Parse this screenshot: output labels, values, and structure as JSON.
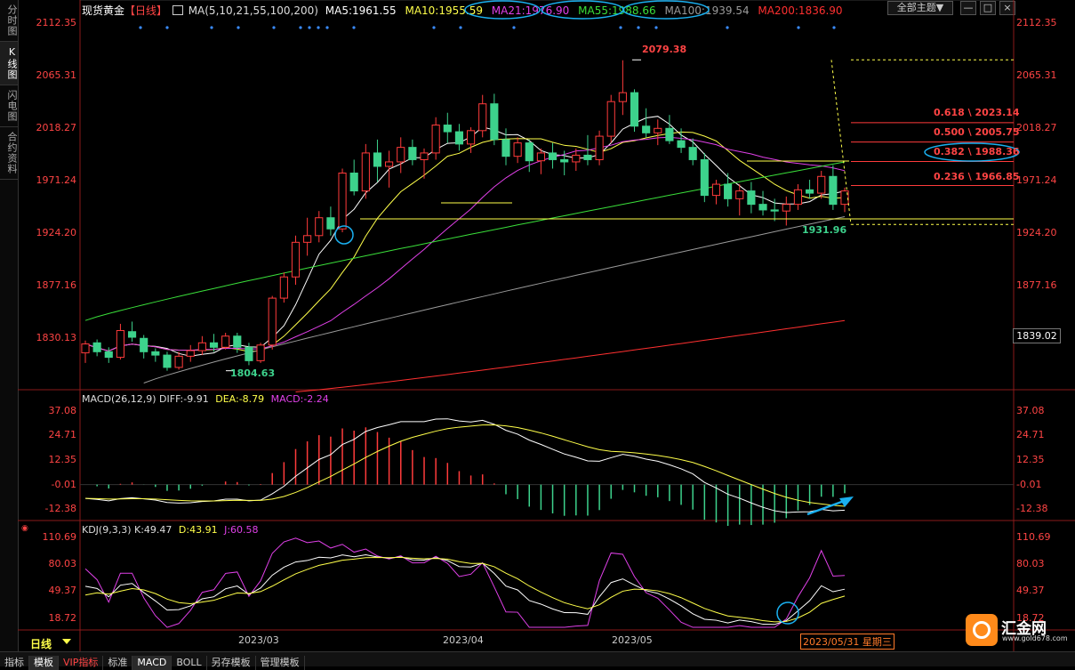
{
  "side_tabs": [
    "分时图",
    "K线图",
    "闪电图",
    "合约资料"
  ],
  "header": {
    "symbol": "现货黄金",
    "period": "【日线】",
    "ma_params": "MA(5,10,21,55,100,200)",
    "ma5": "MA5:1961.55",
    "ma10": "MA10:1955.59",
    "ma21": "MA21:1976.90",
    "ma55": "MA55:1988.66",
    "ma100": "MA100:1939.54",
    "ma200": "MA200:1836.90",
    "theme_button": "全部主题▼"
  },
  "colors": {
    "up": "#ff3b3b",
    "down": "#3dd28c",
    "ma5": "#ffffff",
    "ma10": "#ffff4a",
    "ma21": "#e040e8",
    "ma55": "#3adf3a",
    "ma100": "#9a9a9a",
    "ma200": "#ff3030",
    "axis_label": "#ff4444",
    "annotation_circle": "#1ab0f0"
  },
  "main_axis_labels": [
    "2112.35",
    "2065.31",
    "2018.27",
    "1971.24",
    "1924.20",
    "1877.16",
    "1830.13"
  ],
  "current_price_label": "1839.02",
  "fib_levels": [
    "0.618 \\ 2023.14",
    "0.500 \\ 2005.75",
    "0.382 \\ 1988.36",
    "0.236 \\ 1966.85"
  ],
  "price_annotations": {
    "high": "2079.38",
    "low1": "1804.63",
    "low2": "1931.96"
  },
  "macd": {
    "title": "MACD(26,12,9)",
    "diff": "DIFF:-9.91",
    "dea": "DEA:-8.79",
    "macd": "MACD:-2.24",
    "axis_labels": [
      "37.08",
      "24.71",
      "12.35",
      "-0.01",
      "-12.38"
    ]
  },
  "kdj": {
    "title": "KDJ(9,3,3)",
    "k": "K:49.47",
    "d": "D:43.91",
    "j": "J:60.58",
    "axis_labels": [
      "110.69",
      "80.03",
      "49.37",
      "18.72"
    ]
  },
  "x_labels": [
    "2023/03",
    "2023/04",
    "2023/05"
  ],
  "period_label": "日线",
  "date_label": "2023/05/31 星期三",
  "bottom_tabs": [
    "指标",
    "模板",
    "VIP指标",
    "标准",
    "MACD",
    "BOLL",
    "另存模板",
    "管理模板"
  ],
  "watermark": {
    "name": "汇金网",
    "url": "www.gold678.com"
  },
  "chart_data": {
    "type": "candlestick",
    "symbol": "现货黄金",
    "period": "日线",
    "ylim": [
      1784,
      2125
    ],
    "x_labels": [
      "2023/03",
      "2023/04",
      "2023/05"
    ],
    "candles": [
      [
        1817,
        1828,
        1808,
        1825
      ],
      [
        1826,
        1829,
        1814,
        1818
      ],
      [
        1818,
        1822,
        1808,
        1813
      ],
      [
        1813,
        1843,
        1811,
        1837
      ],
      [
        1836,
        1845,
        1827,
        1831
      ],
      [
        1830,
        1833,
        1812,
        1818
      ],
      [
        1818,
        1821,
        1809,
        1815
      ],
      [
        1815,
        1818,
        1801,
        1804
      ],
      [
        1804,
        1818,
        1802,
        1814
      ],
      [
        1814,
        1824,
        1809,
        1819
      ],
      [
        1819,
        1832,
        1815,
        1826
      ],
      [
        1826,
        1834,
        1818,
        1822
      ],
      [
        1822,
        1835,
        1820,
        1832
      ],
      [
        1832,
        1835,
        1817,
        1822
      ],
      [
        1822,
        1826,
        1806,
        1810
      ],
      [
        1810,
        1826,
        1808,
        1824
      ],
      [
        1824,
        1868,
        1820,
        1866
      ],
      [
        1866,
        1889,
        1862,
        1885
      ],
      [
        1885,
        1922,
        1878,
        1916
      ],
      [
        1916,
        1938,
        1904,
        1922
      ],
      [
        1922,
        1944,
        1916,
        1938
      ],
      [
        1938,
        1948,
        1922,
        1928
      ],
      [
        1928,
        1982,
        1925,
        1978
      ],
      [
        1978,
        1990,
        1958,
        1962
      ],
      [
        1962,
        2004,
        1955,
        1996
      ],
      [
        1996,
        2008,
        1970,
        1984
      ],
      [
        1984,
        1998,
        1965,
        1988
      ],
      [
        1988,
        2010,
        1978,
        2001
      ],
      [
        2001,
        2008,
        1985,
        1990
      ],
      [
        1990,
        2000,
        1973,
        1996
      ],
      [
        1996,
        2028,
        1990,
        2021
      ],
      [
        2021,
        2032,
        2005,
        2015
      ],
      [
        2015,
        2022,
        1998,
        2004
      ],
      [
        2004,
        2019,
        1996,
        2016
      ],
      [
        2016,
        2048,
        2010,
        2040
      ],
      [
        2040,
        2049,
        2003,
        2008
      ],
      [
        2008,
        2018,
        1985,
        1993
      ],
      [
        1993,
        2010,
        1987,
        2005
      ],
      [
        2005,
        2008,
        1979,
        1989
      ],
      [
        1989,
        2000,
        1977,
        1996
      ],
      [
        1996,
        2005,
        1982,
        1990
      ],
      [
        1990,
        1998,
        1976,
        1988
      ],
      [
        1988,
        2000,
        1980,
        1994
      ],
      [
        1994,
        2012,
        1985,
        1990
      ],
      [
        1990,
        2016,
        1985,
        2011
      ],
      [
        2011,
        2048,
        2005,
        2042
      ],
      [
        2042,
        2079,
        2030,
        2050
      ],
      [
        2050,
        2053,
        2015,
        2020
      ],
      [
        2020,
        2036,
        2010,
        2014
      ],
      [
        2014,
        2026,
        2003,
        2018
      ],
      [
        2018,
        2030,
        2004,
        2007
      ],
      [
        2007,
        2018,
        1996,
        2001
      ],
      [
        2001,
        2009,
        1985,
        1990
      ],
      [
        1990,
        1996,
        1952,
        1958
      ],
      [
        1958,
        1972,
        1950,
        1968
      ],
      [
        1968,
        1978,
        1948,
        1955
      ],
      [
        1955,
        1968,
        1940,
        1962
      ],
      [
        1962,
        1970,
        1942,
        1950
      ],
      [
        1950,
        1962,
        1940,
        1945
      ],
      [
        1945,
        1955,
        1935,
        1944
      ],
      [
        1944,
        1957,
        1931,
        1950
      ],
      [
        1950,
        1968,
        1945,
        1963
      ],
      [
        1963,
        1972,
        1955,
        1960
      ],
      [
        1960,
        1980,
        1955,
        1975
      ],
      [
        1975,
        1985,
        1945,
        1950
      ],
      [
        1950,
        1965,
        1943,
        1962
      ]
    ],
    "moving_averages": [
      {
        "name": "MA5",
        "color": "#ffffff"
      },
      {
        "name": "MA10",
        "color": "#ffff4a"
      },
      {
        "name": "MA21",
        "color": "#e040e8"
      },
      {
        "name": "MA55",
        "color": "#3adf3a"
      },
      {
        "name": "MA100",
        "color": "#9a9a9a"
      },
      {
        "name": "MA200",
        "color": "#ff3030"
      }
    ],
    "fibonacci": [
      {
        "ratio": 0.618,
        "price": 2023.14
      },
      {
        "ratio": 0.5,
        "price": 2005.75
      },
      {
        "ratio": 0.382,
        "price": 1988.36
      },
      {
        "ratio": 0.236,
        "price": 1966.85
      }
    ],
    "macd": {
      "params": "26,12,9",
      "diff": -9.91,
      "dea": -8.79,
      "macd": -2.24,
      "ylim": [
        -18,
        40
      ]
    },
    "kdj": {
      "params": "9,3,3",
      "k": 49.47,
      "d": 43.91,
      "j": 60.58,
      "ylim": [
        5,
        115
      ]
    }
  }
}
